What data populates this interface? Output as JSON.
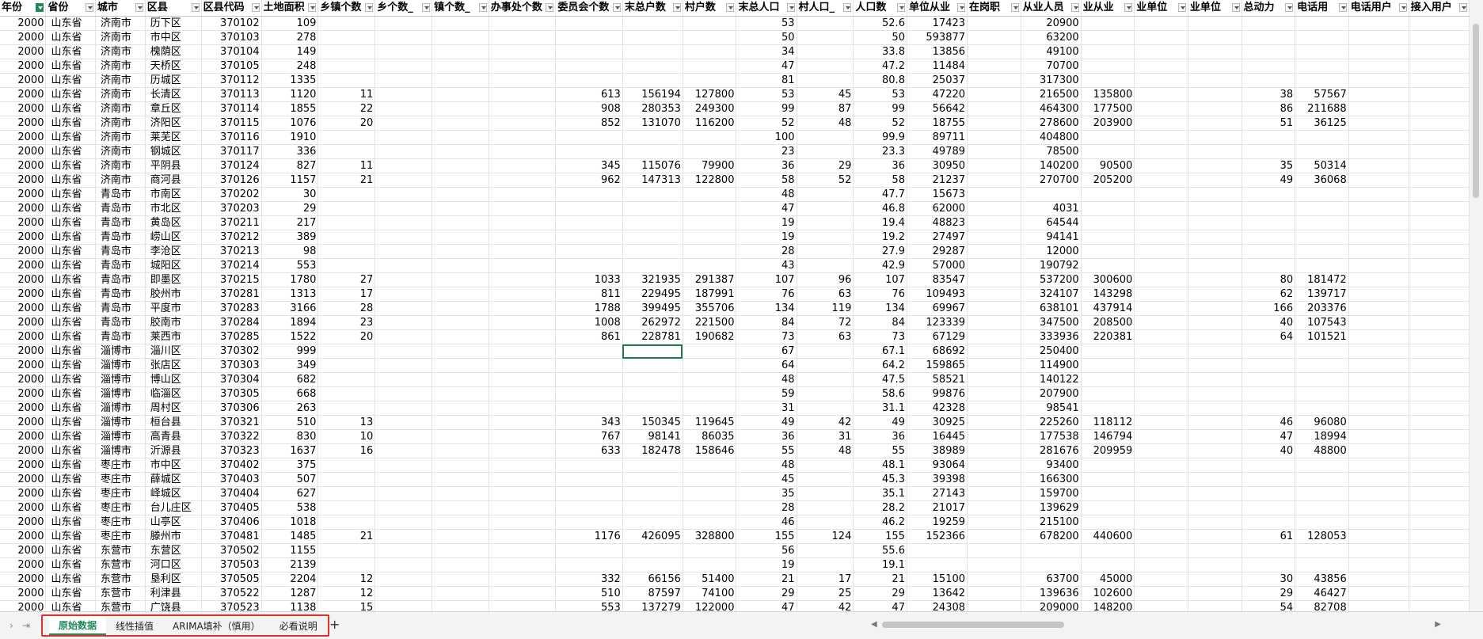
{
  "sheet": {
    "headers": [
      "年份",
      "省份",
      "城市",
      "区县",
      "区县代码",
      "土地面积",
      "乡镇个数",
      "乡个数_",
      "镇个数_",
      "办事处个数",
      "委员会个数",
      "末总户数",
      "村户数",
      "末总人口",
      "村人口_",
      "人口数",
      "单位从业",
      "在岗职",
      "从业人员",
      "业从业",
      "业单位",
      "业单位",
      "总动力",
      "电话用",
      "电话用户",
      "接入用户"
    ],
    "widths": [
      70,
      72,
      73,
      72,
      72,
      60,
      60,
      72,
      72,
      72,
      72,
      72,
      72,
      72,
      72,
      72,
      72,
      72,
      72,
      72,
      72,
      72,
      72,
      72,
      72,
      72
    ],
    "filter_active_col": 0,
    "selected_cell": {
      "row": 23,
      "col": 11
    },
    "rows": [
      [
        "2000",
        "山东省",
        "济南市",
        "历下区",
        "370102",
        "109",
        "",
        "",
        "",
        "",
        "",
        "",
        "",
        "53",
        "",
        "52.6",
        "17423",
        "",
        "20900",
        "",
        "",
        "",
        "",
        "",
        "",
        ""
      ],
      [
        "2000",
        "山东省",
        "济南市",
        "市中区",
        "370103",
        "278",
        "",
        "",
        "",
        "",
        "",
        "",
        "",
        "50",
        "",
        "50",
        "593877",
        "",
        "63200",
        "",
        "",
        "",
        "",
        "",
        "",
        ""
      ],
      [
        "2000",
        "山东省",
        "济南市",
        "槐荫区",
        "370104",
        "149",
        "",
        "",
        "",
        "",
        "",
        "",
        "",
        "34",
        "",
        "33.8",
        "13856",
        "",
        "49100",
        "",
        "",
        "",
        "",
        "",
        "",
        ""
      ],
      [
        "2000",
        "山东省",
        "济南市",
        "天桥区",
        "370105",
        "248",
        "",
        "",
        "",
        "",
        "",
        "",
        "",
        "47",
        "",
        "47.2",
        "11484",
        "",
        "70700",
        "",
        "",
        "",
        "",
        "",
        "",
        ""
      ],
      [
        "2000",
        "山东省",
        "济南市",
        "历城区",
        "370112",
        "1335",
        "",
        "",
        "",
        "",
        "",
        "",
        "",
        "81",
        "",
        "80.8",
        "25037",
        "",
        "317300",
        "",
        "",
        "",
        "",
        "",
        "",
        ""
      ],
      [
        "2000",
        "山东省",
        "济南市",
        "长清区",
        "370113",
        "1120",
        "11",
        "",
        "",
        "",
        "613",
        "156194",
        "127800",
        "53",
        "45",
        "53",
        "47220",
        "",
        "216500",
        "135800",
        "",
        "",
        "38",
        "57567",
        "",
        ""
      ],
      [
        "2000",
        "山东省",
        "济南市",
        "章丘区",
        "370114",
        "1855",
        "22",
        "",
        "",
        "",
        "908",
        "280353",
        "249300",
        "99",
        "87",
        "99",
        "56642",
        "",
        "464300",
        "177500",
        "",
        "",
        "86",
        "211688",
        "",
        ""
      ],
      [
        "2000",
        "山东省",
        "济南市",
        "济阳区",
        "370115",
        "1076",
        "20",
        "",
        "",
        "",
        "852",
        "131070",
        "116200",
        "52",
        "48",
        "52",
        "18755",
        "",
        "278600",
        "203900",
        "",
        "",
        "51",
        "36125",
        "",
        ""
      ],
      [
        "2000",
        "山东省",
        "济南市",
        "莱芜区",
        "370116",
        "1910",
        "",
        "",
        "",
        "",
        "",
        "",
        "",
        "100",
        "",
        "99.9",
        "89711",
        "",
        "404800",
        "",
        "",
        "",
        "",
        "",
        "",
        ""
      ],
      [
        "2000",
        "山东省",
        "济南市",
        "钢城区",
        "370117",
        "336",
        "",
        "",
        "",
        "",
        "",
        "",
        "",
        "23",
        "",
        "23.3",
        "49789",
        "",
        "78500",
        "",
        "",
        "",
        "",
        "",
        "",
        ""
      ],
      [
        "2000",
        "山东省",
        "济南市",
        "平阴县",
        "370124",
        "827",
        "11",
        "",
        "",
        "",
        "345",
        "115076",
        "79900",
        "36",
        "29",
        "36",
        "30950",
        "",
        "140200",
        "90500",
        "",
        "",
        "35",
        "50314",
        "",
        ""
      ],
      [
        "2000",
        "山东省",
        "济南市",
        "商河县",
        "370126",
        "1157",
        "21",
        "",
        "",
        "",
        "962",
        "147313",
        "122800",
        "58",
        "52",
        "58",
        "21237",
        "",
        "270700",
        "205200",
        "",
        "",
        "49",
        "36068",
        "",
        ""
      ],
      [
        "2000",
        "山东省",
        "青岛市",
        "市南区",
        "370202",
        "30",
        "",
        "",
        "",
        "",
        "",
        "",
        "",
        "48",
        "",
        "47.7",
        "15673",
        "",
        "",
        "",
        "",
        "",
        "",
        "",
        "",
        ""
      ],
      [
        "2000",
        "山东省",
        "青岛市",
        "市北区",
        "370203",
        "29",
        "",
        "",
        "",
        "",
        "",
        "",
        "",
        "47",
        "",
        "46.8",
        "62000",
        "",
        "4031",
        "",
        "",
        "",
        "",
        "",
        "",
        ""
      ],
      [
        "2000",
        "山东省",
        "青岛市",
        "黄岛区",
        "370211",
        "217",
        "",
        "",
        "",
        "",
        "",
        "",
        "",
        "19",
        "",
        "19.4",
        "48823",
        "",
        "64544",
        "",
        "",
        "",
        "",
        "",
        "",
        ""
      ],
      [
        "2000",
        "山东省",
        "青岛市",
        "崂山区",
        "370212",
        "389",
        "",
        "",
        "",
        "",
        "",
        "",
        "",
        "19",
        "",
        "19.2",
        "27497",
        "",
        "94141",
        "",
        "",
        "",
        "",
        "",
        "",
        ""
      ],
      [
        "2000",
        "山东省",
        "青岛市",
        "李沧区",
        "370213",
        "98",
        "",
        "",
        "",
        "",
        "",
        "",
        "",
        "28",
        "",
        "27.9",
        "29287",
        "",
        "12000",
        "",
        "",
        "",
        "",
        "",
        "",
        ""
      ],
      [
        "2000",
        "山东省",
        "青岛市",
        "城阳区",
        "370214",
        "553",
        "",
        "",
        "",
        "",
        "",
        "",
        "",
        "43",
        "",
        "42.9",
        "57000",
        "",
        "190792",
        "",
        "",
        "",
        "",
        "",
        "",
        ""
      ],
      [
        "2000",
        "山东省",
        "青岛市",
        "即墨区",
        "370215",
        "1780",
        "27",
        "",
        "",
        "",
        "1033",
        "321935",
        "291387",
        "107",
        "96",
        "107",
        "83547",
        "",
        "537200",
        "300600",
        "",
        "",
        "80",
        "181472",
        "",
        ""
      ],
      [
        "2000",
        "山东省",
        "青岛市",
        "胶州市",
        "370281",
        "1313",
        "17",
        "",
        "",
        "",
        "811",
        "229495",
        "187991",
        "76",
        "63",
        "76",
        "109493",
        "",
        "324107",
        "143298",
        "",
        "",
        "62",
        "139717",
        "",
        ""
      ],
      [
        "2000",
        "山东省",
        "青岛市",
        "平度市",
        "370283",
        "3166",
        "28",
        "",
        "",
        "",
        "1788",
        "399495",
        "355706",
        "134",
        "119",
        "134",
        "69967",
        "",
        "638101",
        "437914",
        "",
        "",
        "166",
        "203376",
        "",
        ""
      ],
      [
        "2000",
        "山东省",
        "青岛市",
        "胶南市",
        "370284",
        "1894",
        "23",
        "",
        "",
        "",
        "1008",
        "262972",
        "221500",
        "84",
        "72",
        "84",
        "123339",
        "",
        "347500",
        "208500",
        "",
        "",
        "40",
        "107543",
        "",
        ""
      ],
      [
        "2000",
        "山东省",
        "青岛市",
        "莱西市",
        "370285",
        "1522",
        "20",
        "",
        "",
        "",
        "861",
        "228781",
        "190682",
        "73",
        "63",
        "73",
        "67129",
        "",
        "333936",
        "220381",
        "",
        "",
        "64",
        "101521",
        "",
        ""
      ],
      [
        "2000",
        "山东省",
        "淄博市",
        "淄川区",
        "370302",
        "999",
        "",
        "",
        "",
        "",
        "",
        "",
        "",
        "67",
        "",
        "67.1",
        "68692",
        "",
        "250400",
        "",
        "",
        "",
        "",
        "",
        "",
        ""
      ],
      [
        "2000",
        "山东省",
        "淄博市",
        "张店区",
        "370303",
        "349",
        "",
        "",
        "",
        "",
        "",
        "",
        "",
        "64",
        "",
        "64.2",
        "159865",
        "",
        "114900",
        "",
        "",
        "",
        "",
        "",
        "",
        ""
      ],
      [
        "2000",
        "山东省",
        "淄博市",
        "博山区",
        "370304",
        "682",
        "",
        "",
        "",
        "",
        "",
        "",
        "",
        "48",
        "",
        "47.5",
        "58521",
        "",
        "140122",
        "",
        "",
        "",
        "",
        "",
        "",
        ""
      ],
      [
        "2000",
        "山东省",
        "淄博市",
        "临淄区",
        "370305",
        "668",
        "",
        "",
        "",
        "",
        "",
        "",
        "",
        "59",
        "",
        "58.6",
        "99876",
        "",
        "207900",
        "",
        "",
        "",
        "",
        "",
        "",
        ""
      ],
      [
        "2000",
        "山东省",
        "淄博市",
        "周村区",
        "370306",
        "263",
        "",
        "",
        "",
        "",
        "",
        "",
        "",
        "31",
        "",
        "31.1",
        "42328",
        "",
        "98541",
        "",
        "",
        "",
        "",
        "",
        "",
        ""
      ],
      [
        "2000",
        "山东省",
        "淄博市",
        "桓台县",
        "370321",
        "510",
        "13",
        "",
        "",
        "",
        "343",
        "150345",
        "119645",
        "49",
        "42",
        "49",
        "30925",
        "",
        "225260",
        "118112",
        "",
        "",
        "46",
        "96080",
        "",
        ""
      ],
      [
        "2000",
        "山东省",
        "淄博市",
        "高青县",
        "370322",
        "830",
        "10",
        "",
        "",
        "",
        "767",
        "98141",
        "86035",
        "36",
        "31",
        "36",
        "16445",
        "",
        "177538",
        "146794",
        "",
        "",
        "47",
        "18994",
        "",
        ""
      ],
      [
        "2000",
        "山东省",
        "淄博市",
        "沂源县",
        "370323",
        "1637",
        "16",
        "",
        "",
        "",
        "633",
        "182478",
        "158646",
        "55",
        "48",
        "55",
        "38989",
        "",
        "281676",
        "209959",
        "",
        "",
        "40",
        "48800",
        "",
        ""
      ],
      [
        "2000",
        "山东省",
        "枣庄市",
        "市中区",
        "370402",
        "375",
        "",
        "",
        "",
        "",
        "",
        "",
        "",
        "48",
        "",
        "48.1",
        "93064",
        "",
        "93400",
        "",
        "",
        "",
        "",
        "",
        "",
        ""
      ],
      [
        "2000",
        "山东省",
        "枣庄市",
        "薛城区",
        "370403",
        "507",
        "",
        "",
        "",
        "",
        "",
        "",
        "",
        "45",
        "",
        "45.3",
        "39398",
        "",
        "166300",
        "",
        "",
        "",
        "",
        "",
        "",
        ""
      ],
      [
        "2000",
        "山东省",
        "枣庄市",
        "峄城区",
        "370404",
        "627",
        "",
        "",
        "",
        "",
        "",
        "",
        "",
        "35",
        "",
        "35.1",
        "27143",
        "",
        "159700",
        "",
        "",
        "",
        "",
        "",
        "",
        ""
      ],
      [
        "2000",
        "山东省",
        "枣庄市",
        "台儿庄区",
        "370405",
        "538",
        "",
        "",
        "",
        "",
        "",
        "",
        "",
        "28",
        "",
        "28.2",
        "21017",
        "",
        "139629",
        "",
        "",
        "",
        "",
        "",
        "",
        ""
      ],
      [
        "2000",
        "山东省",
        "枣庄市",
        "山亭区",
        "370406",
        "1018",
        "",
        "",
        "",
        "",
        "",
        "",
        "",
        "46",
        "",
        "46.2",
        "19259",
        "",
        "215100",
        "",
        "",
        "",
        "",
        "",
        "",
        ""
      ],
      [
        "2000",
        "山东省",
        "枣庄市",
        "滕州市",
        "370481",
        "1485",
        "21",
        "",
        "",
        "",
        "1176",
        "426095",
        "328800",
        "155",
        "124",
        "155",
        "152366",
        "",
        "678200",
        "440600",
        "",
        "",
        "61",
        "128053",
        "",
        ""
      ],
      [
        "2000",
        "山东省",
        "东营市",
        "东营区",
        "370502",
        "1155",
        "",
        "",
        "",
        "",
        "",
        "",
        "",
        "56",
        "",
        "55.6",
        "",
        "",
        "",
        "",
        "",
        "",
        "",
        "",
        "",
        ""
      ],
      [
        "2000",
        "山东省",
        "东营市",
        "河口区",
        "370503",
        "2139",
        "",
        "",
        "",
        "",
        "",
        "",
        "",
        "19",
        "",
        "19.1",
        "",
        "",
        "",
        "",
        "",
        "",
        "",
        "",
        "",
        ""
      ],
      [
        "2000",
        "山东省",
        "东营市",
        "垦利区",
        "370505",
        "2204",
        "12",
        "",
        "",
        "",
        "332",
        "66156",
        "51400",
        "21",
        "17",
        "21",
        "15100",
        "",
        "63700",
        "45000",
        "",
        "",
        "30",
        "43856",
        "",
        ""
      ],
      [
        "2000",
        "山东省",
        "东营市",
        "利津县",
        "370522",
        "1287",
        "12",
        "",
        "",
        "",
        "510",
        "87597",
        "74100",
        "29",
        "25",
        "29",
        "13642",
        "",
        "139636",
        "102600",
        "",
        "",
        "29",
        "46427",
        "",
        ""
      ],
      [
        "2000",
        "山东省",
        "东营市",
        "广饶县",
        "370523",
        "1138",
        "15",
        "",
        "",
        "",
        "553",
        "137279",
        "122000",
        "47",
        "42",
        "47",
        "24308",
        "",
        "209000",
        "148200",
        "",
        "",
        "54",
        "82708",
        "",
        ""
      ]
    ]
  },
  "tabs": [
    "原始数据",
    "线性插值",
    "ARIMA填补（慎用）",
    "必看说明"
  ],
  "active_tab": 0,
  "add_sheet_label": "+"
}
